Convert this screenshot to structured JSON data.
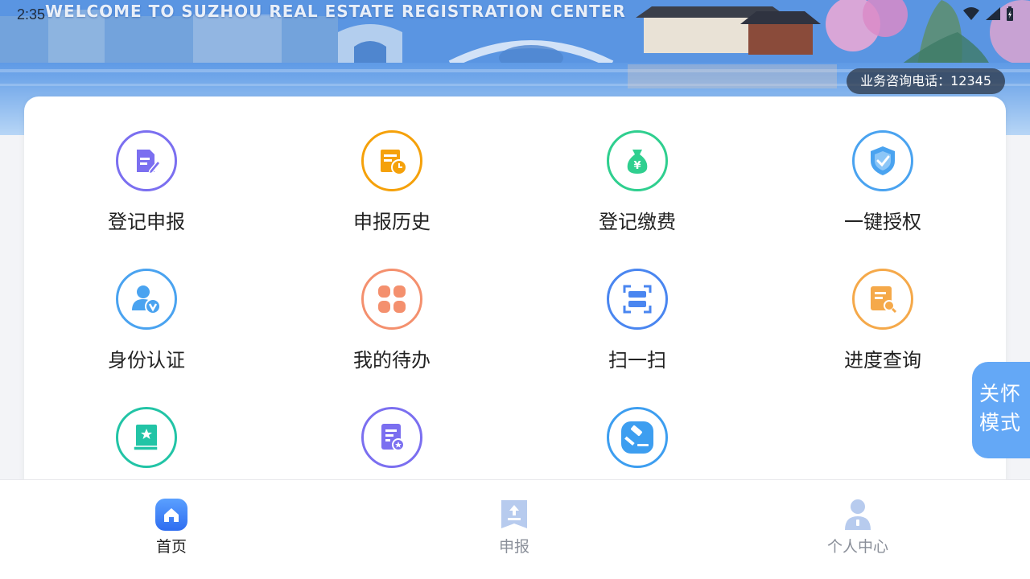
{
  "status_bar": {
    "time": "2:35"
  },
  "banner": {
    "title": "WELCOME TO SUZHOU REAL ESTATE REGISTRATION CENTER",
    "hotline": "业务咨询电话：12345"
  },
  "grid": [
    {
      "label": "登记申报",
      "icon": "file-edit-icon",
      "color": "#7b6ff0"
    },
    {
      "label": "申报历史",
      "icon": "history-doc-icon",
      "color": "#f5a10a"
    },
    {
      "label": "登记缴费",
      "icon": "money-bag-icon",
      "color": "#2fcf8f"
    },
    {
      "label": "一键授权",
      "icon": "shield-check-icon",
      "color": "#4aa3f0"
    },
    {
      "label": "身份认证",
      "icon": "user-verify-icon",
      "color": "#4aa3f0"
    },
    {
      "label": "我的待办",
      "icon": "grid-four-icon",
      "color": "#f4906e"
    },
    {
      "label": "扫一扫",
      "icon": "scan-icon",
      "color": "#4a86f0"
    },
    {
      "label": "进度查询",
      "icon": "search-doc-icon",
      "color": "#f5a94a"
    },
    {
      "label": "",
      "icon": "book-star-icon",
      "color": "#22c4a6"
    },
    {
      "label": "",
      "icon": "doc-star-icon",
      "color": "#7b6ff0"
    },
    {
      "label": "",
      "icon": "gavel-icon",
      "color": "#3d9ef0"
    }
  ],
  "care_mode": {
    "line1": "关怀",
    "line2": "模式"
  },
  "bottom_nav": {
    "items": [
      {
        "label": "首页",
        "icon": "home-icon",
        "active": true
      },
      {
        "label": "申报",
        "icon": "upload-doc-icon",
        "active": false
      },
      {
        "label": "个人中心",
        "icon": "person-icon",
        "active": false
      }
    ]
  },
  "colors": {
    "nav_active": "#222222",
    "nav_inactive": "#8a8f99",
    "accent": "#3f7df0"
  }
}
